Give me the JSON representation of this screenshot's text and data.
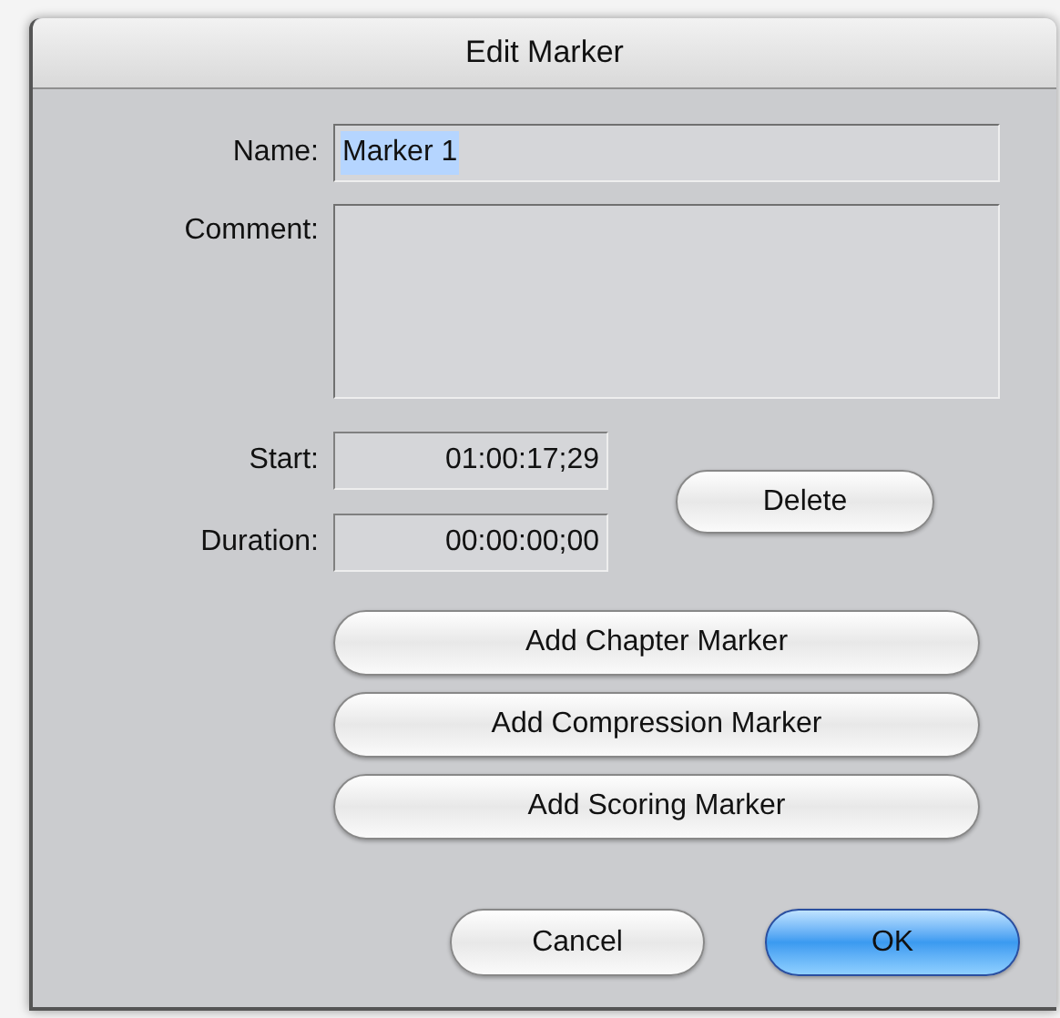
{
  "window": {
    "title": "Edit Marker"
  },
  "name_field": {
    "label": "Name:",
    "value": "Marker 1",
    "text_selected": true
  },
  "comment_field": {
    "label": "Comment:"
  },
  "start_field": {
    "label": "Start:",
    "value": "01:00:17;29"
  },
  "duration_field": {
    "label": "Duration:",
    "value": "00:00:00;00"
  },
  "delete_button": {
    "label": "Delete"
  },
  "marker_buttons": [
    {
      "label": "Add Chapter Marker"
    },
    {
      "label": "Add Compression Marker"
    },
    {
      "label": "Add Scoring Marker"
    }
  ],
  "dialog_buttons": [
    {
      "label": "Cancel",
      "default": false
    },
    {
      "label": "OK",
      "default": true
    }
  ]
}
